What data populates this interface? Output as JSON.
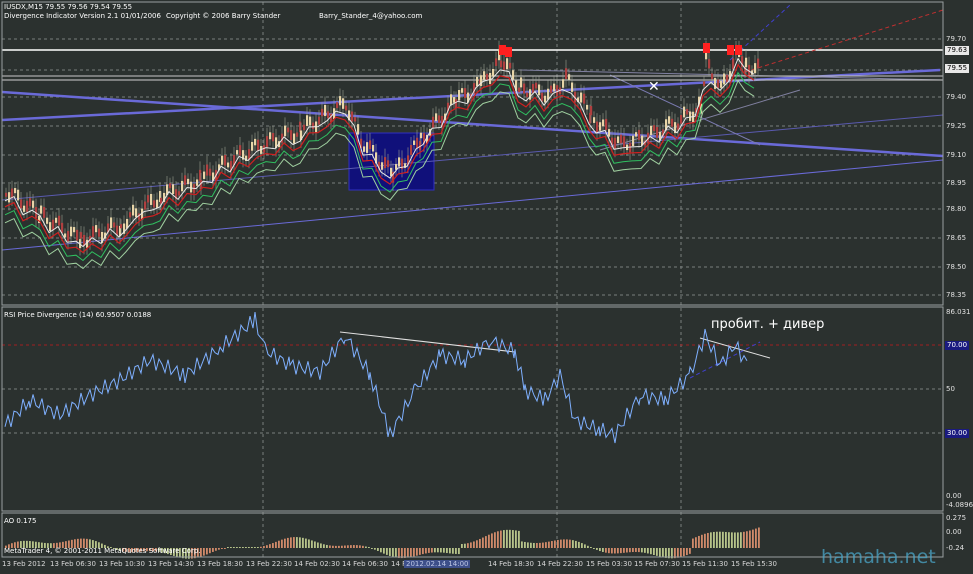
{
  "header": {
    "symbol_line": "IUSDX,M15  79.55 79.56 79.54 79.55",
    "indicator_line": "Divergence Indicator Version 2.1  01/01/2006",
    "copyright": "Copyright © 2006 Barry Stander",
    "email": "Barry_Stander_4@yahoo.com"
  },
  "colors": {
    "background": "#2b312f",
    "grid": "#7a7f7d",
    "bull_candle": "#e8d5a8",
    "bear_candle": "#b04040",
    "rsi_line": "#7fb0ff",
    "ao_up": "#d08a6a",
    "ao_down": "#b7c48a",
    "trend_blue": "#6a6ad8",
    "red_dash": "#c03030",
    "white_level": "#ffffff",
    "signal_red": "#ff2020"
  },
  "price_panel": {
    "y_ticks": [
      "79.70",
      "79.55",
      "79.40",
      "79.25",
      "79.10",
      "78.95",
      "78.80",
      "78.65",
      "78.50",
      "78.35"
    ],
    "tags": [
      "79.63",
      "79.55"
    ]
  },
  "rsi_panel": {
    "title": "RSI Price Divergence (14) 60.9507 0.0188",
    "y_ticks": [
      "86.031",
      "50",
      "0.00",
      "-4.0896"
    ],
    "tags": [
      "70.00",
      "30.00"
    ],
    "annotation": "пробит. + дивер"
  },
  "ao_panel": {
    "title": "AO 0.175",
    "y_ticks": [
      "0.275",
      "0.00",
      "-0.24"
    ]
  },
  "footer": {
    "platform": "MetaTrader 4, © 2001-2011 MetaQuotes Software Corp.",
    "watermark": "hamaha.net"
  },
  "x_ticks": [
    "13 Feb 2012",
    "13 Feb 06:30",
    "13 Feb 10:30",
    "13 Feb 14:30",
    "13 Feb 18:30",
    "13 Feb 22:30",
    "14 Feb 02:30",
    "14 Feb 06:30",
    "14 Feb 10:30",
    "2012.02.14 14:00",
    "14 Feb 18:30",
    "14 Feb 22:30",
    "15 Feb 03:30",
    "15 Feb 07:30",
    "15 Feb 11:30",
    "15 Feb 15:30"
  ]
}
